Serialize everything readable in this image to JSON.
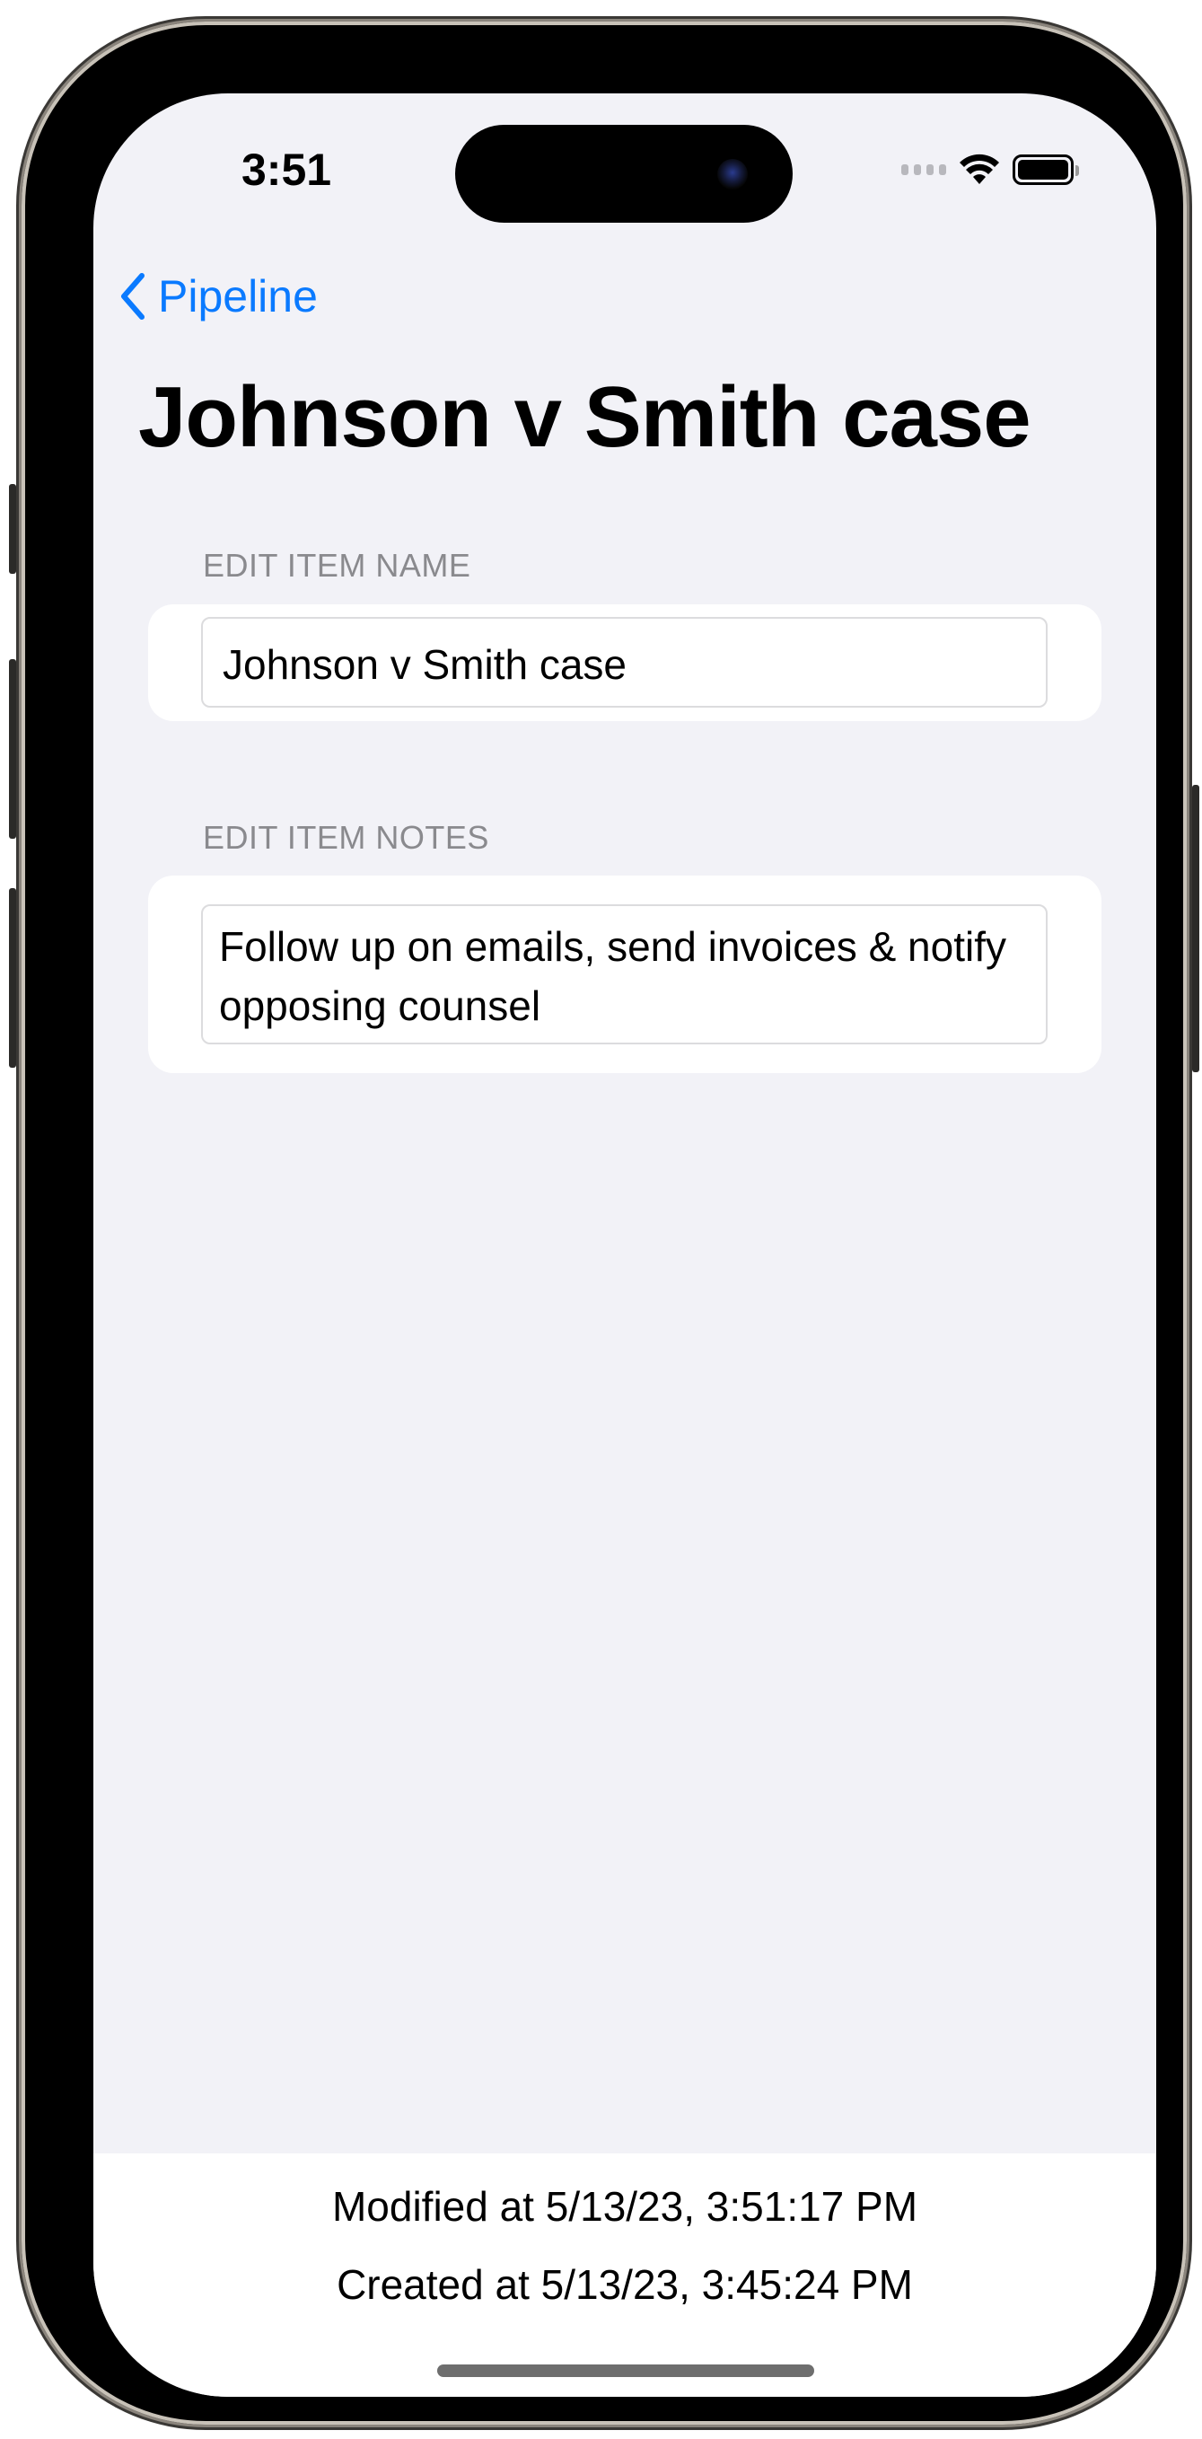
{
  "status_bar": {
    "time": "3:51",
    "icons": [
      "cellular-signal-icon",
      "wifi-icon",
      "battery-icon"
    ]
  },
  "nav": {
    "back_label": "Pipeline",
    "back_icon": "chevron-left-icon"
  },
  "page": {
    "title": "Johnson v Smith case"
  },
  "form": {
    "name_section_label": "EDIT ITEM NAME",
    "name_value": "Johnson v Smith case",
    "notes_section_label": "EDIT ITEM NOTES",
    "notes_value": "Follow up on emails, send invoices & notify opposing counsel"
  },
  "footer": {
    "modified": "Modified at 5/13/23, 3:51:17 PM",
    "created": "Created at 5/13/23, 3:45:24 PM"
  },
  "colors": {
    "accent": "#0a7aff",
    "background": "#f2f2f7",
    "section_label": "#8a8a8e"
  }
}
